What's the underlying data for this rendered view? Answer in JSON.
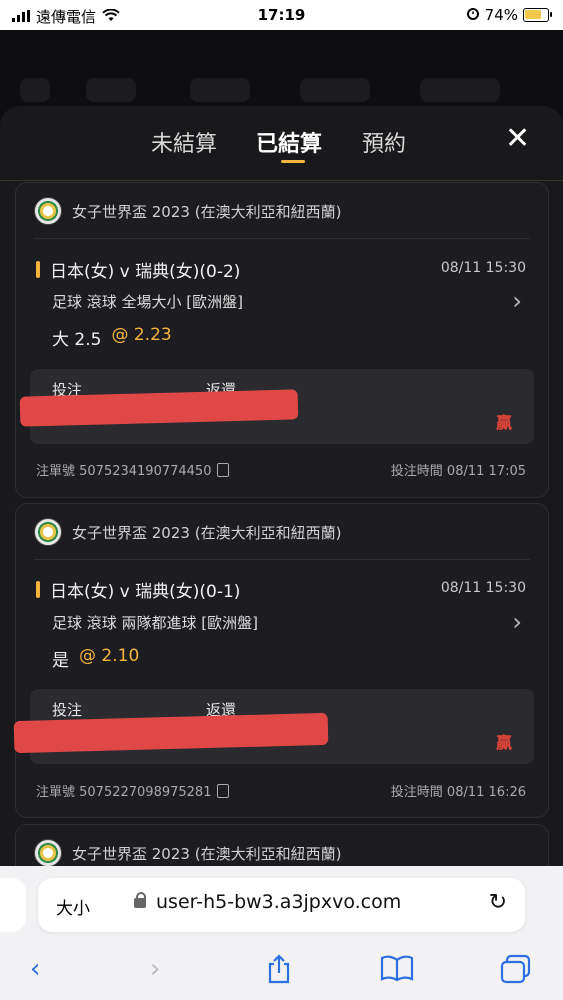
{
  "status": {
    "carrier": "遠傳電信",
    "time": "17:19",
    "battery": "74%",
    "battery_level": 0.74
  },
  "tabs": [
    {
      "label": "未結算",
      "active": false
    },
    {
      "label": "已結算",
      "active": true
    },
    {
      "label": "預約",
      "active": false
    }
  ],
  "close_icon": "close-icon",
  "bets": [
    {
      "league": "女子世界盃 2023 (在澳大利亞和紐西蘭)",
      "match": "日本(女) v 瑞典(女)(0-2)",
      "match_time": "08/11 15:30",
      "market": "足球 滾球  全場大小  [歐洲盤]",
      "selection": "大 2.5",
      "odds": "@ 2.23",
      "stake_label": "投注",
      "return_label": "返還",
      "result": "贏",
      "bet_no": "注單號 5075234190774450",
      "bet_time": "投注時間 08/11 17:05"
    },
    {
      "league": "女子世界盃 2023 (在澳大利亞和紐西蘭)",
      "match": "日本(女) v 瑞典(女)(0-1)",
      "match_time": "08/11 15:30",
      "market": "足球 滾球  兩隊都進球  [歐洲盤]",
      "selection": "是",
      "odds": "@ 2.10",
      "stake_label": "投注",
      "return_label": "返還",
      "result": "贏",
      "bet_no": "注單號 5075227098975281",
      "bet_time": "投注時間 08/11 16:26"
    },
    {
      "league": "女子世界盃 2023 (在澳大利亞和紐西蘭)"
    }
  ],
  "browser": {
    "text_size": "大小",
    "url": "user-h5-bw3.a3jpxvo.com"
  },
  "colors": {
    "accent": "#f5b43c",
    "win": "#e0453b",
    "sheet": "#19191c"
  }
}
